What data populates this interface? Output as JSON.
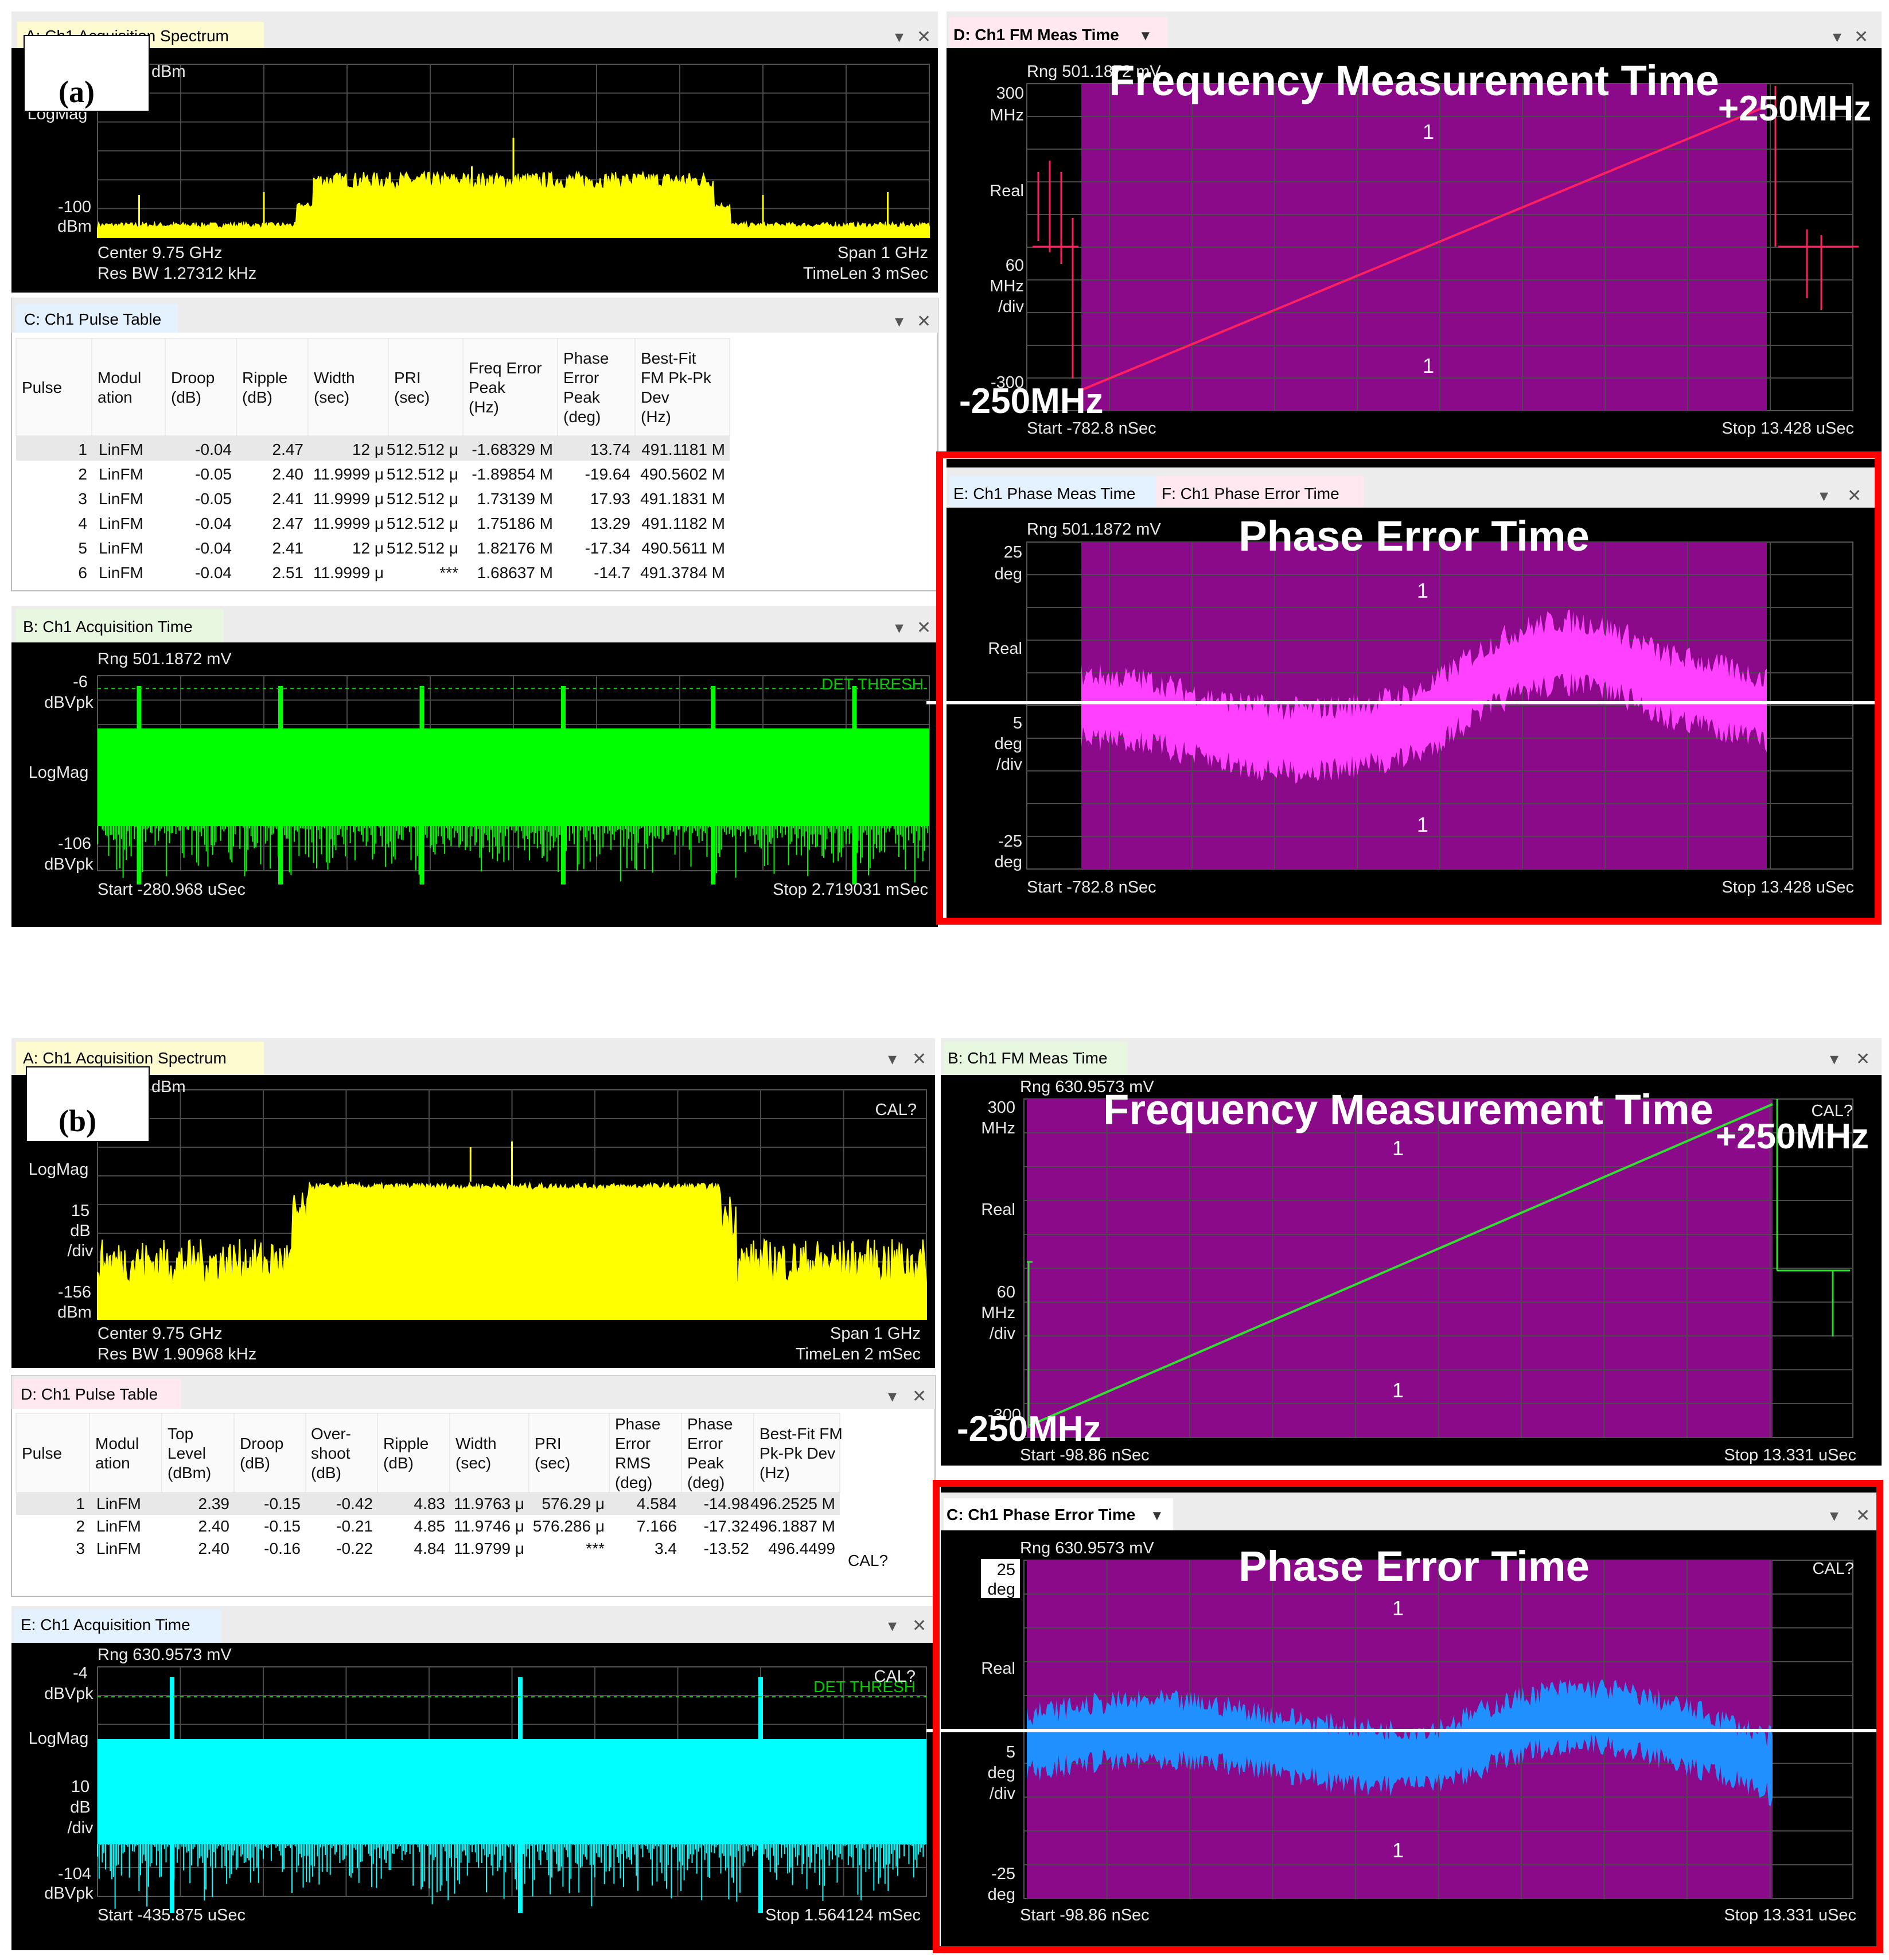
{
  "panel_a": {
    "label": "(a)",
    "spectrum": {
      "tab": "A: Ch1 Acquisition Spectrum",
      "unit_top": "dBm",
      "unit_top2": "dBm",
      "format": "LogMag",
      "bottom_val": "-100",
      "bottom_unit": "dBm",
      "center": "Center 9.75 GHz",
      "span": "Span 1 GHz",
      "resbw": "Res BW 1.27312 kHz",
      "timelen": "TimeLen 3 mSec",
      "trace_color": "#ffff00"
    },
    "pulse_table": {
      "tab": "C: Ch1 Pulse Table",
      "headers": [
        [
          "Pulse"
        ],
        [
          "Modul",
          "ation"
        ],
        [
          "Droop",
          "(dB)"
        ],
        [
          "Ripple",
          "(dB)"
        ],
        [
          "Width",
          "(sec)"
        ],
        [
          "PRI",
          "(sec)"
        ],
        [
          "Freq Error",
          "Peak",
          "(Hz)"
        ],
        [
          "Phase",
          "Error",
          "Peak",
          "(deg)"
        ],
        [
          "Best-Fit",
          "FM Pk-Pk",
          "Dev",
          "(Hz)"
        ]
      ],
      "rows": [
        [
          "1",
          "LinFM",
          "-0.04",
          "2.47",
          "12 μ",
          "512.512 μ",
          "-1.68329 M",
          "13.74",
          "491.1181 M"
        ],
        [
          "2",
          "LinFM",
          "-0.05",
          "2.40",
          "11.9999 μ",
          "512.512 μ",
          "-1.89854 M",
          "-19.64",
          "490.5602 M"
        ],
        [
          "3",
          "LinFM",
          "-0.05",
          "2.41",
          "11.9999 μ",
          "512.512 μ",
          "1.73139 M",
          "17.93",
          "491.1831 M"
        ],
        [
          "4",
          "LinFM",
          "-0.04",
          "2.47",
          "11.9999 μ",
          "512.512 μ",
          "1.75186 M",
          "13.29",
          "491.1182 M"
        ],
        [
          "5",
          "LinFM",
          "-0.04",
          "2.41",
          "12 μ",
          "512.512 μ",
          "1.82176 M",
          "-17.34",
          "490.5611 M"
        ],
        [
          "6",
          "LinFM",
          "-0.04",
          "2.51",
          "11.9999 μ",
          "***",
          "1.68637 M",
          "-14.7",
          "491.3784 M"
        ]
      ]
    },
    "acq_time": {
      "tab": "B: Ch1 Acquisition Time",
      "rng": "Rng 501.1872 mV",
      "top_val": "-6",
      "top_unit": "dBVpk",
      "format": "LogMag",
      "bottom_val": "-106",
      "bottom_unit": "dBVpk",
      "thresh": "DET THRESH",
      "start": "Start -280.968 uSec",
      "stop": "Stop 2.719031 mSec",
      "trace_color": "#00ff00"
    },
    "fm_time": {
      "tab": "D: Ch1 FM Meas Time",
      "rng": "Rng 501.1872 mV",
      "title": "Frequency Measurement Time",
      "top_val": "300",
      "top_unit": "MHz",
      "format": "Real",
      "div_val": "60",
      "div_unit": "MHz",
      "div_word": "/div",
      "bottom_val": "-300",
      "marker_hi": "+250MHz",
      "marker_lo": "-250MHz",
      "one_label": "1",
      "start": "Start -782.8 nSec",
      "stop": "Stop 13.428 uSec",
      "trace_color": "#ff2060"
    },
    "phase_time": {
      "tab1": "E: Ch1 Phase Meas Time",
      "tab2": "F: Ch1 Phase Error Time",
      "rng": "Rng 501.1872 mV",
      "title": "Phase Error Time",
      "top_val": "25",
      "top_unit": "deg",
      "format": "Real",
      "div_val": "5",
      "div_unit": "deg",
      "div_word": "/div",
      "bottom_val": "-25",
      "bottom_unit": "deg",
      "one_label": "1",
      "start": "Start -782.8 nSec",
      "stop": "Stop 13.428 uSec",
      "trace_color": "#ff40ff"
    }
  },
  "panel_b": {
    "label": "(b)",
    "spectrum": {
      "tab": "A: Ch1 Acquisition Spectrum",
      "unit_top": "dBm",
      "cal": "CAL?",
      "format": "LogMag",
      "div_val": "15",
      "div_unit": "dB",
      "div_word": "/div",
      "bottom_val": "-156",
      "bottom_unit": "dBm",
      "center": "Center 9.75 GHz",
      "span": "Span 1 GHz",
      "resbw": "Res BW 1.90968 kHz",
      "timelen": "TimeLen 2 mSec",
      "trace_color": "#ffff00"
    },
    "pulse_table": {
      "tab": "D: Ch1 Pulse Table",
      "headers": [
        [
          "Pulse"
        ],
        [
          "Modul",
          "ation"
        ],
        [
          "Top",
          "Level",
          "(dBm)"
        ],
        [
          "Droop",
          "(dB)"
        ],
        [
          "Over-",
          "shoot",
          "(dB)"
        ],
        [
          "Ripple",
          "(dB)"
        ],
        [
          "Width",
          "(sec)"
        ],
        [
          "PRI",
          "(sec)"
        ],
        [
          "Phase",
          "Error",
          "RMS",
          "(deg)"
        ],
        [
          "Phase",
          "Error",
          "Peak",
          "(deg)"
        ],
        [
          "Best-Fit FM",
          "Pk-Pk Dev",
          "(Hz)"
        ]
      ],
      "rows": [
        [
          "1",
          "LinFM",
          "2.39",
          "-0.15",
          "-0.42",
          "4.83",
          "11.9763 μ",
          "576.29 μ",
          "4.584",
          "-14.98",
          "496.2525 M"
        ],
        [
          "2",
          "LinFM",
          "2.40",
          "-0.15",
          "-0.21",
          "4.85",
          "11.9746 μ",
          "576.286 μ",
          "7.166",
          "-17.32",
          "496.1887 M"
        ],
        [
          "3",
          "LinFM",
          "2.40",
          "-0.16",
          "-0.22",
          "4.84",
          "11.9799 μ",
          "***",
          "3.4",
          "-13.52",
          "496.4499"
        ]
      ],
      "cal": "CAL?"
    },
    "acq_time": {
      "tab": "E: Ch1 Acquisition Time",
      "rng": "Rng 630.9573 mV",
      "top_val": "-4",
      "top_unit": "dBVpk",
      "format": "LogMag",
      "div_val": "10",
      "div_unit": "dB",
      "div_word": "/div",
      "bottom_val": "-104",
      "bottom_unit": "dBVpk",
      "thresh": "DET THRESH",
      "cal": "CAL?",
      "start": "Start -435.875 uSec",
      "stop": "Stop 1.564124 mSec",
      "trace_color": "#00ffff"
    },
    "fm_time": {
      "tab": "B: Ch1 FM Meas Time",
      "rng": "Rng 630.9573 mV",
      "title": "Frequency Measurement Time",
      "cal": "CAL?",
      "top_val": "300",
      "top_unit": "MHz",
      "format": "Real",
      "div_val": "60",
      "div_unit": "MHz",
      "div_word": "/div",
      "bottom_val": "-300",
      "marker_hi": "+250MHz",
      "marker_lo": "-250MHz",
      "one_label": "1",
      "start": "Start -98.86 nSec",
      "stop": "Stop 13.331 uSec",
      "trace_color": "#30e030"
    },
    "phase_time": {
      "tab": "C: Ch1 Phase Error Time",
      "rng": "Rng 630.9573 mV",
      "title": "Phase Error Time",
      "cal": "CAL?",
      "top_val": "25",
      "top_unit": "deg",
      "format": "Real",
      "div_val": "5",
      "div_unit": "deg",
      "div_word": "/div",
      "bottom_val": "-25",
      "bottom_unit": "deg",
      "one_label": "1",
      "start": "Start -98.86 nSec",
      "stop": "Stop 13.331 uSec",
      "trace_color": "#2090ff"
    }
  },
  "colors": {
    "plot_bg": "#000000",
    "purple": "#8a0a8a",
    "grid": "#4a4a4a",
    "highlight": "#ff0000",
    "tab_yellow": "#fffbd0",
    "tab_blue": "#e4f2ff",
    "tab_green": "#e8f8e0",
    "tab_pink": "#ffe8f0"
  }
}
